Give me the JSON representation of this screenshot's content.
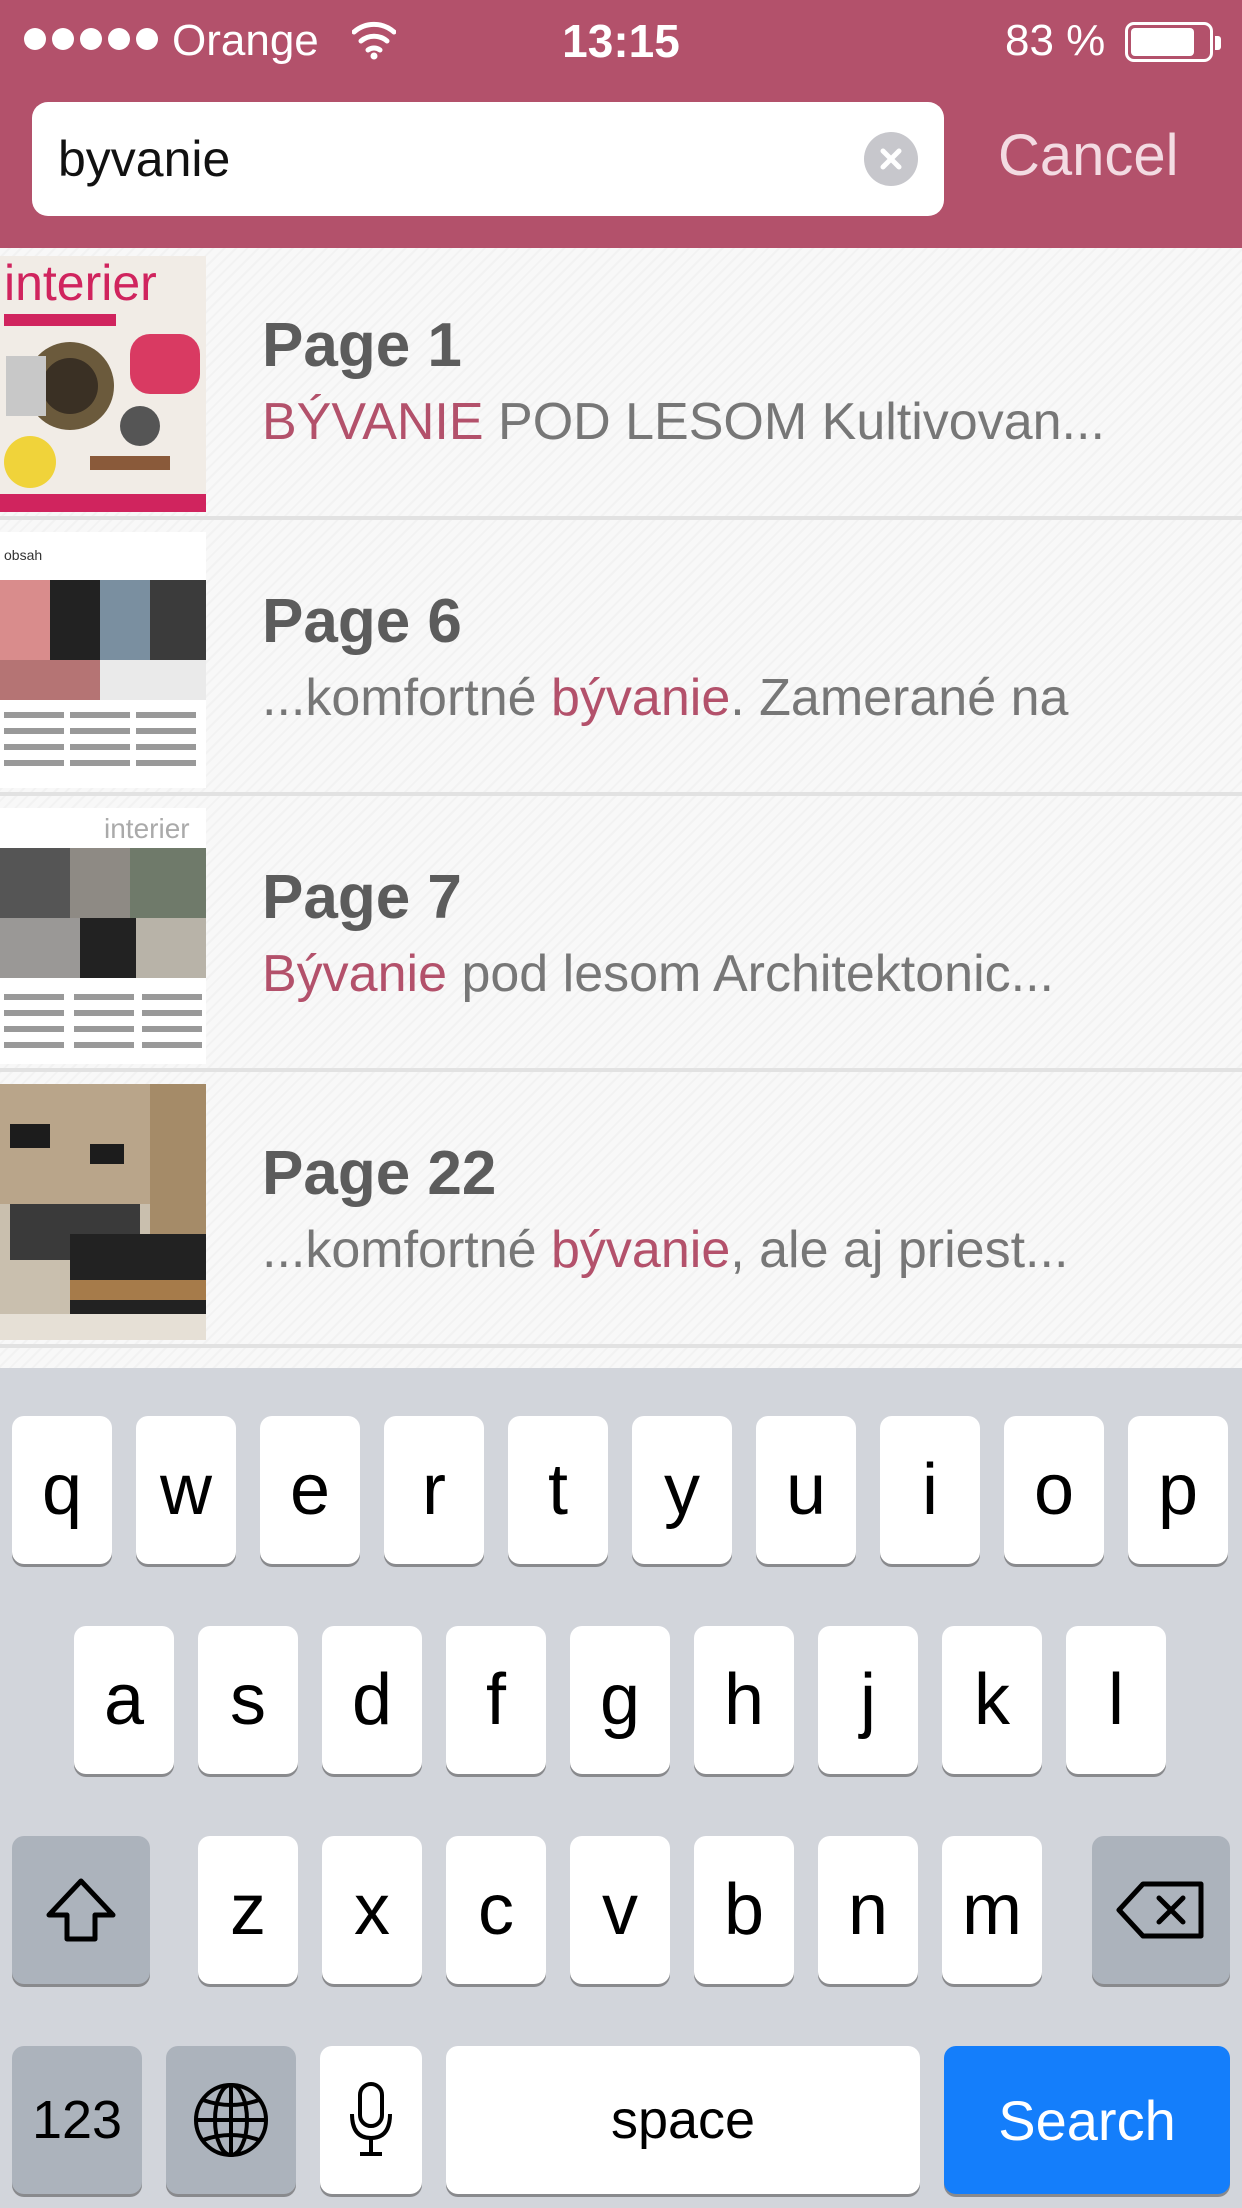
{
  "status_bar": {
    "carrier": "Orange",
    "time": "13:15",
    "battery_percent": "83 %",
    "battery_level": 0.83,
    "signal_bars": 5
  },
  "search": {
    "query": "byvanie",
    "cancel_label": "Cancel"
  },
  "colors": {
    "accent": "#b3516b",
    "keyboard_action": "#147efb"
  },
  "results": [
    {
      "title": "Page 1",
      "snippet_before": "",
      "snippet_match": "BÝVANIE",
      "snippet_after": " POD LESOM Kultivovan...",
      "thumbnail": "interier-cover-thumbnail"
    },
    {
      "title": "Page 6",
      "snippet_before": "...komfortné ",
      "snippet_match": "bývanie",
      "snippet_after": ". Zamerané na",
      "thumbnail": "obsah-page-thumbnail"
    },
    {
      "title": "Page 7",
      "snippet_before": "",
      "snippet_match": "Bývanie",
      "snippet_after": " pod lesom Architektonic...",
      "thumbnail": "interier-spread-thumbnail"
    },
    {
      "title": "Page 22",
      "snippet_before": "...komfortné ",
      "snippet_match": "bývanie",
      "snippet_after": ", ale aj priest...",
      "thumbnail": "interior-photo-thumbnail"
    }
  ],
  "keyboard": {
    "row1": [
      "q",
      "w",
      "e",
      "r",
      "t",
      "y",
      "u",
      "i",
      "o",
      "p"
    ],
    "row2": [
      "a",
      "s",
      "d",
      "f",
      "g",
      "h",
      "j",
      "k",
      "l"
    ],
    "row3": [
      "z",
      "x",
      "c",
      "v",
      "b",
      "n",
      "m"
    ],
    "numbers_label": "123",
    "space_label": "space",
    "search_label": "Search",
    "shift_icon": "shift-icon",
    "delete_icon": "backspace-icon",
    "globe_icon": "globe-icon",
    "mic_icon": "microphone-icon"
  }
}
